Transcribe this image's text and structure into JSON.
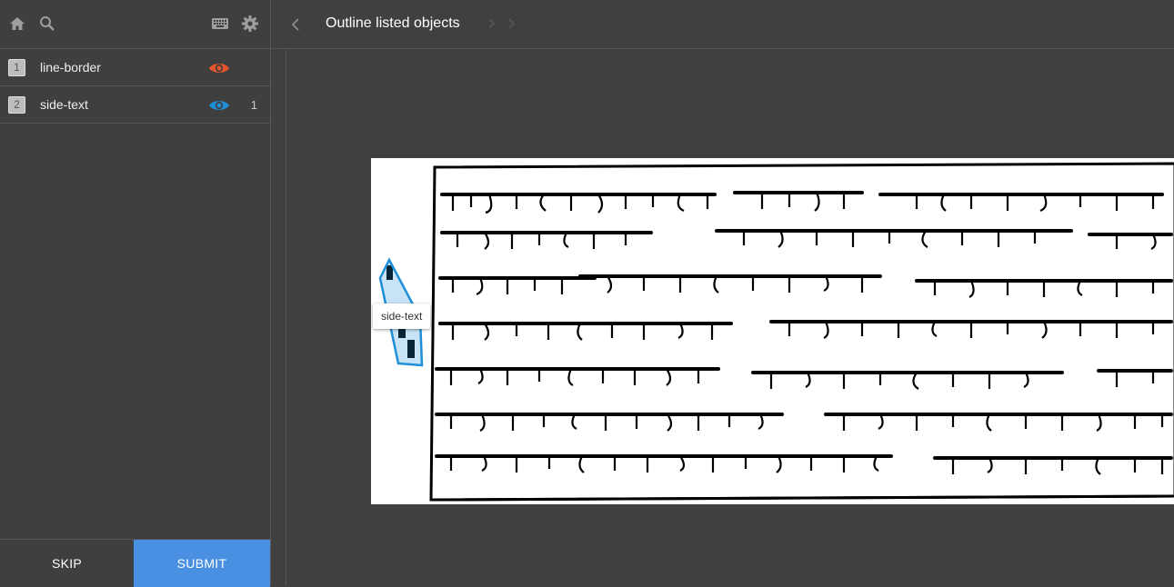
{
  "header": {
    "title": "Outline listed objects"
  },
  "labels": [
    {
      "hotkey": "1",
      "name": "line-border",
      "color": "#e8542a",
      "count": ""
    },
    {
      "hotkey": "2",
      "name": "side-text",
      "color": "#1e8fd8",
      "count": "1"
    }
  ],
  "buttons": {
    "skip": "SKIP",
    "submit": "SUBMIT"
  },
  "annotation": {
    "tooltip": "side-text",
    "color": "#1e8fd8"
  },
  "icons": {
    "home": "home-icon",
    "search": "search-icon",
    "keyboard": "keyboard-icon",
    "settings": "gear-icon",
    "back": "chevron-left-icon",
    "eye": "eye-icon"
  }
}
